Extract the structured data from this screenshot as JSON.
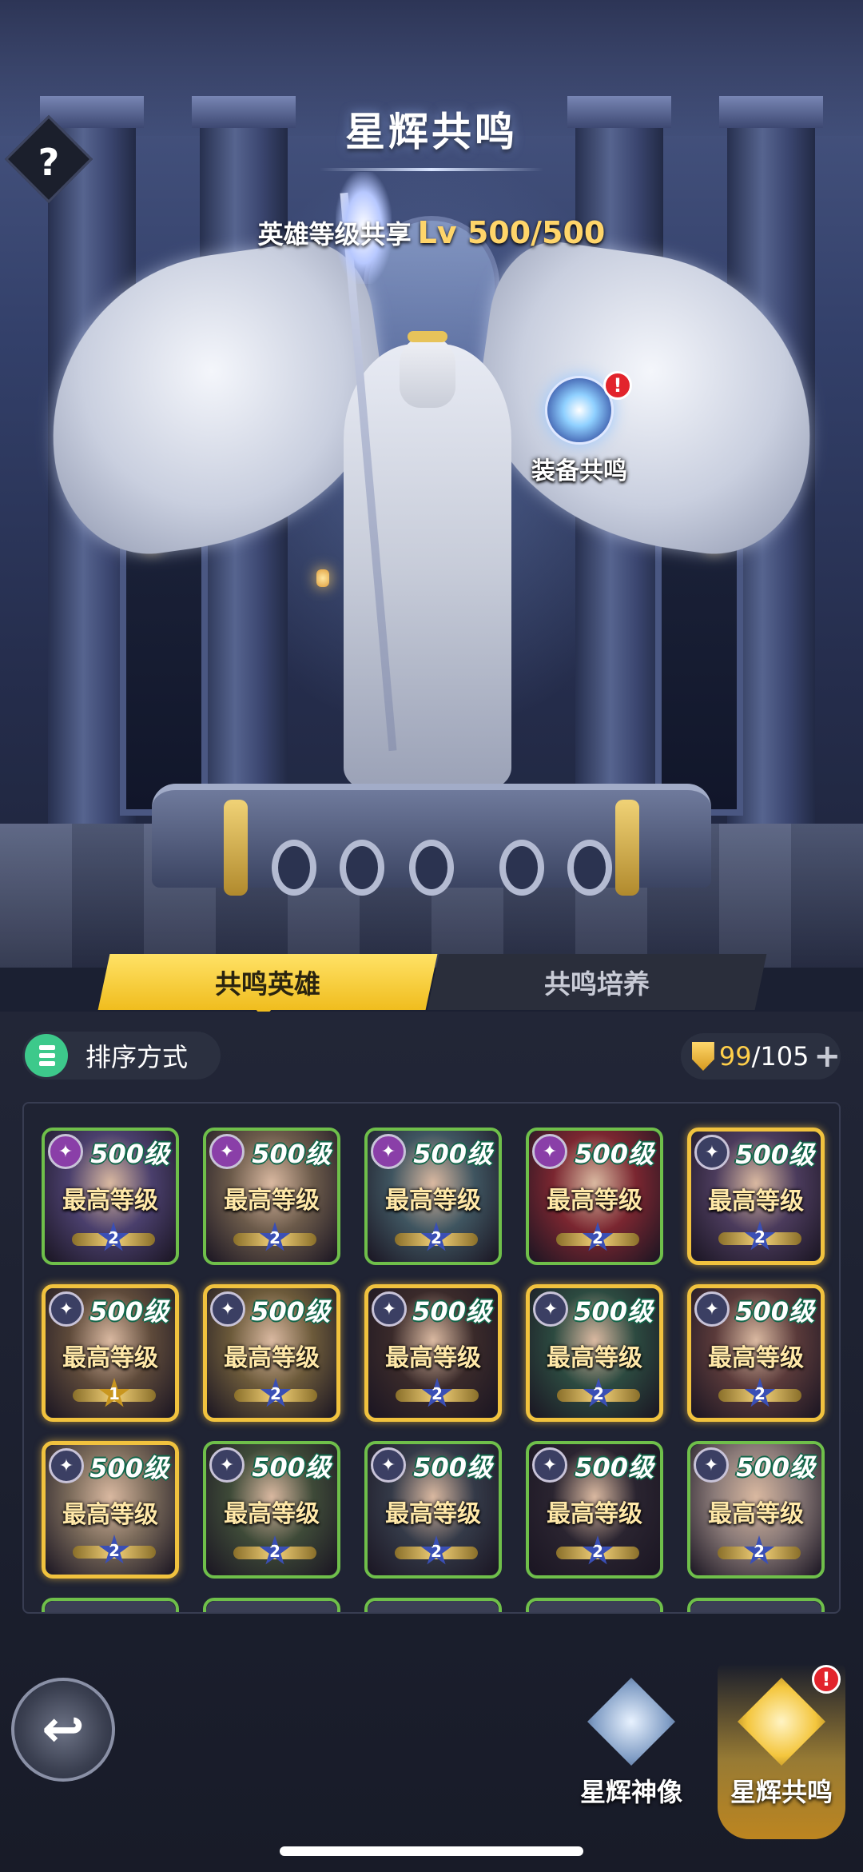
{
  "header": {
    "title": "星辉共鸣",
    "help_label": "?",
    "level_share_label": "英雄等级共享",
    "level_share_value": "Lv 500/500"
  },
  "equip_resonance": {
    "label": "装备共鸣",
    "alert": "!"
  },
  "tabs": [
    {
      "label": "共鸣英雄",
      "active": true
    },
    {
      "label": "共鸣培养",
      "active": false
    }
  ],
  "toolbar": {
    "sort_label": "排序方式",
    "capacity_current": "99",
    "capacity_total": "/105",
    "add_label": "+"
  },
  "heroes": [
    {
      "level": "500级",
      "status": "最高等级",
      "rank": "2",
      "frame": "green",
      "faction": "purple",
      "portrait": "#4a3f6c"
    },
    {
      "level": "500级",
      "status": "最高等级",
      "rank": "2",
      "frame": "green",
      "faction": "purple",
      "portrait": "#6b5a4a"
    },
    {
      "level": "500级",
      "status": "最高等级",
      "rank": "2",
      "frame": "green",
      "faction": "purple",
      "portrait": "#3f5560"
    },
    {
      "level": "500级",
      "status": "最高等级",
      "rank": "2",
      "frame": "green",
      "faction": "purple",
      "portrait": "#7a2630"
    },
    {
      "level": "500级",
      "status": "最高等级",
      "rank": "2",
      "frame": "gold",
      "faction": "blue",
      "portrait": "#4b3b5c"
    },
    {
      "level": "500级",
      "status": "最高等级",
      "rank": "1",
      "frame": "gold",
      "faction": "blue",
      "portrait": "#5e4a3a"
    },
    {
      "level": "500级",
      "status": "最高等级",
      "rank": "2",
      "frame": "gold",
      "faction": "blue",
      "portrait": "#6c5a3a"
    },
    {
      "level": "500级",
      "status": "最高等级",
      "rank": "2",
      "frame": "gold",
      "faction": "blue",
      "portrait": "#3a2a2a"
    },
    {
      "level": "500级",
      "status": "最高等级",
      "rank": "2",
      "frame": "gold",
      "faction": "blue",
      "portrait": "#2c4a40"
    },
    {
      "level": "500级",
      "status": "最高等级",
      "rank": "2",
      "frame": "gold",
      "faction": "blue",
      "portrait": "#5a3a3a"
    },
    {
      "level": "500级",
      "status": "最高等级",
      "rank": "2",
      "frame": "gold",
      "faction": "blue",
      "portrait": "#7a6a5a"
    },
    {
      "level": "500级",
      "status": "最高等级",
      "rank": "2",
      "frame": "green",
      "faction": "blue",
      "portrait": "#3e4a38"
    },
    {
      "level": "500级",
      "status": "最高等级",
      "rank": "2",
      "frame": "green",
      "faction": "blue",
      "portrait": "#343a48"
    },
    {
      "level": "500级",
      "status": "最高等级",
      "rank": "2",
      "frame": "green",
      "faction": "blue",
      "portrait": "#2a2430"
    },
    {
      "level": "500级",
      "status": "最高等级",
      "rank": "2",
      "frame": "green",
      "faction": "blue",
      "portrait": "#8a7a78"
    }
  ],
  "bottom_nav": [
    {
      "label": "星辉神像",
      "icon": "statue-emblem-icon",
      "active": false
    },
    {
      "label": "星辉共鸣",
      "icon": "resonance-emblem-icon",
      "active": true,
      "alert": "!"
    }
  ],
  "colors": {
    "accent": "#f0bd1e",
    "frame_green": "#6fbf4a",
    "frame_gold": "#f1c23e",
    "level_outline": "#12664a",
    "alert": "#e2242c"
  }
}
